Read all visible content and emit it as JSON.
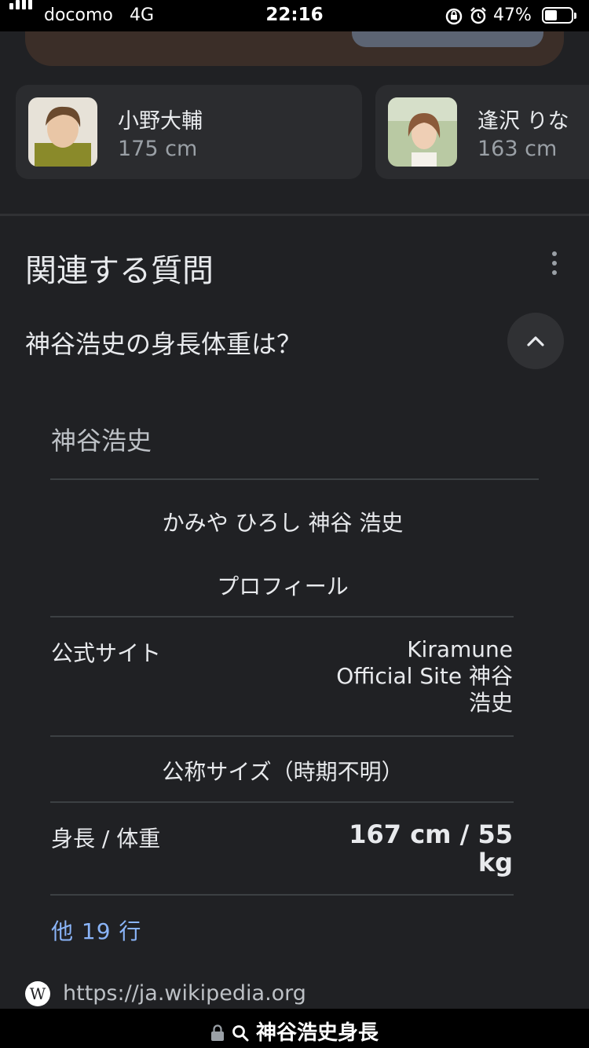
{
  "status_bar": {
    "carrier": "docomo",
    "network": "4G",
    "time": "22:16",
    "battery_percent": "47%",
    "battery_level": 0.47
  },
  "actors": [
    {
      "name": "小野大輔",
      "height": "175 cm"
    },
    {
      "name": "逢沢 りな",
      "height": "163 cm"
    }
  ],
  "related_questions": {
    "title": "関連する質問",
    "question": "神谷浩史の身長体重は？",
    "answer": {
      "person_name": "神谷浩史",
      "reading": "かみや ひろし 神谷 浩史",
      "profile_header": "プロフィール",
      "official_site_label": "公式サイト",
      "official_site_value_lines": [
        "Kiramune",
        "Official Site 神谷",
        "浩史"
      ],
      "size_header": "公称サイズ（時期不明）",
      "height_weight_label": "身長 / 体重",
      "height_weight_value_lines": [
        "167 cm / 55",
        "kg"
      ],
      "more_rows": "他 19 行"
    },
    "source": {
      "icon_letter": "W",
      "url": "https://ja.wikipedia.org"
    }
  },
  "bottom_bar": {
    "query": "神谷浩史身長"
  },
  "colors": {
    "background": "#202124",
    "link": "#8ab4f8",
    "card": "#2b2c2f"
  }
}
